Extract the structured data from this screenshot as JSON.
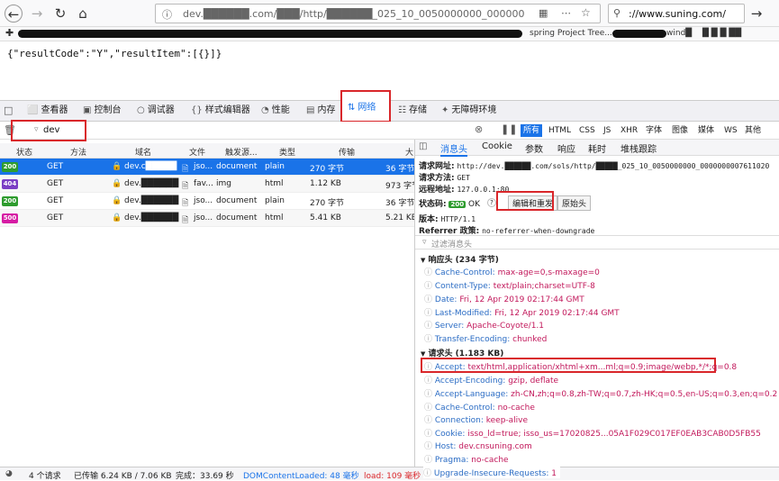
{
  "browser": {
    "url": "dev.██████.com/███/http/██████_025_10_0050000000_000000000",
    "search_text": "://www.suning.com/"
  },
  "bookmarks": [
    "spring Project Tree...",
    "wind█",
    "█ █ █ ██"
  ],
  "page": {
    "json_text": "{\"resultCode\":\"Y\",\"resultItem\":[{}]}"
  },
  "devtools": {
    "tabs": [
      {
        "icon": "⬜",
        "label": "查看器"
      },
      {
        "icon": "▣",
        "label": "控制台"
      },
      {
        "icon": "○",
        "label": "调试器"
      },
      {
        "icon": "{}",
        "label": "样式编辑器"
      },
      {
        "icon": "◔",
        "label": "性能"
      },
      {
        "icon": "▤",
        "label": "内存"
      },
      {
        "icon": "⇅",
        "label": "网络"
      },
      {
        "icon": "☷",
        "label": "存储"
      },
      {
        "icon": "✦",
        "label": "无障碍环境"
      }
    ],
    "filter_value": "dev",
    "type_filters": [
      "所有",
      "HTML",
      "CSS",
      "JS",
      "XHR",
      "字体",
      "图像",
      "媒体",
      "WS",
      "其他"
    ],
    "columns": [
      "状态",
      "方法",
      "域名",
      "文件",
      "触发源...",
      "类型",
      "传输",
      "大"
    ],
    "rows": [
      {
        "status": "200",
        "color": "#2e9c2e",
        "method": "GET",
        "domain": "dev.c█████",
        "file": "jso...",
        "cause": "document",
        "type": "plain",
        "transfer": "270 字节",
        "size": "36 字节"
      },
      {
        "status": "404",
        "color": "#7b3fc4",
        "method": "GET",
        "domain": "dev.██████",
        "file": "fav...",
        "cause": "img",
        "type": "html",
        "transfer": "1.12 KB",
        "size": "973 字节"
      },
      {
        "status": "200",
        "color": "#2e9c2e",
        "method": "GET",
        "domain": "dev.██████",
        "file": "jso...",
        "cause": "document",
        "type": "plain",
        "transfer": "270 字节",
        "size": "36 字节"
      },
      {
        "status": "500",
        "color": "#d61ca4",
        "method": "GET",
        "domain": "dev.██████",
        "file": "jso...",
        "cause": "document",
        "type": "html",
        "transfer": "5.41 KB",
        "size": "5.21 KB"
      }
    ],
    "detail_tabs": [
      "消息头",
      "Cookie",
      "参数",
      "响应",
      "耗时",
      "堆栈跟踪"
    ],
    "request_url_label": "请求网址:",
    "request_url": "http://dev.██████.com/sols/http/█████_025_10_0050000000_0000000007611020",
    "method_label": "请求方法:",
    "method": "GET",
    "remote_label": "远程地址:",
    "remote": "127.0.0.1:80",
    "status_label": "状态码:",
    "status_code": "200",
    "status_text": "OK",
    "edit_resend": "编辑和重发",
    "raw_headers": "原始头",
    "version_label": "版本:",
    "version": "HTTP/1.1",
    "referrer_label": "Referrer 政策:",
    "referrer": "no-referrer-when-downgrade",
    "filter_headers_placeholder": "过滤消息头",
    "response_section": "响应头 (234 字节)",
    "response_headers": [
      {
        "k": "Cache-Control:",
        "v": "max-age=0,s-maxage=0"
      },
      {
        "k": "Content-Type:",
        "v": "text/plain;charset=UTF-8"
      },
      {
        "k": "Date:",
        "v": "Fri, 12 Apr 2019 02:17:44 GMT"
      },
      {
        "k": "Last-Modified:",
        "v": "Fri, 12 Apr 2019 02:17:44 GMT"
      },
      {
        "k": "Server:",
        "v": "Apache-Coyote/1.1"
      },
      {
        "k": "Transfer-Encoding:",
        "v": "chunked"
      }
    ],
    "request_section": "请求头 (1.183 KB)",
    "request_headers": [
      {
        "k": "Accept:",
        "v": "text/html,application/xhtml+xm...ml;q=0.9;image/webp,*/*;q=0.8"
      },
      {
        "k": "Accept-Encoding:",
        "v": "gzip, deflate"
      },
      {
        "k": "Accept-Language:",
        "v": "zh-CN,zh;q=0.8,zh-TW;q=0.7,zh-HK;q=0.5,en-US;q=0.3,en;q=0.2"
      },
      {
        "k": "Cache-Control:",
        "v": "no-cache"
      },
      {
        "k": "Connection:",
        "v": "keep-alive"
      },
      {
        "k": "Cookie:",
        "v": "isso_ld=true; isso_us=17020825...05A1F029C017EF0EAB3CAB0D5FB55"
      },
      {
        "k": "Host:",
        "v": "dev.cnsuning.com"
      },
      {
        "k": "Pragma:",
        "v": "no-cache"
      },
      {
        "k": "Upgrade-Insecure-Requests:",
        "v": "1"
      }
    ],
    "status_bar": {
      "requests": "4 个请求",
      "transferred": "已传输 6.24 KB / 7.06 KB",
      "finish": "完成：33.69 秒",
      "dcl": "DOMContentLoaded: 48 毫秒",
      "load": "load: 109 毫秒"
    }
  }
}
